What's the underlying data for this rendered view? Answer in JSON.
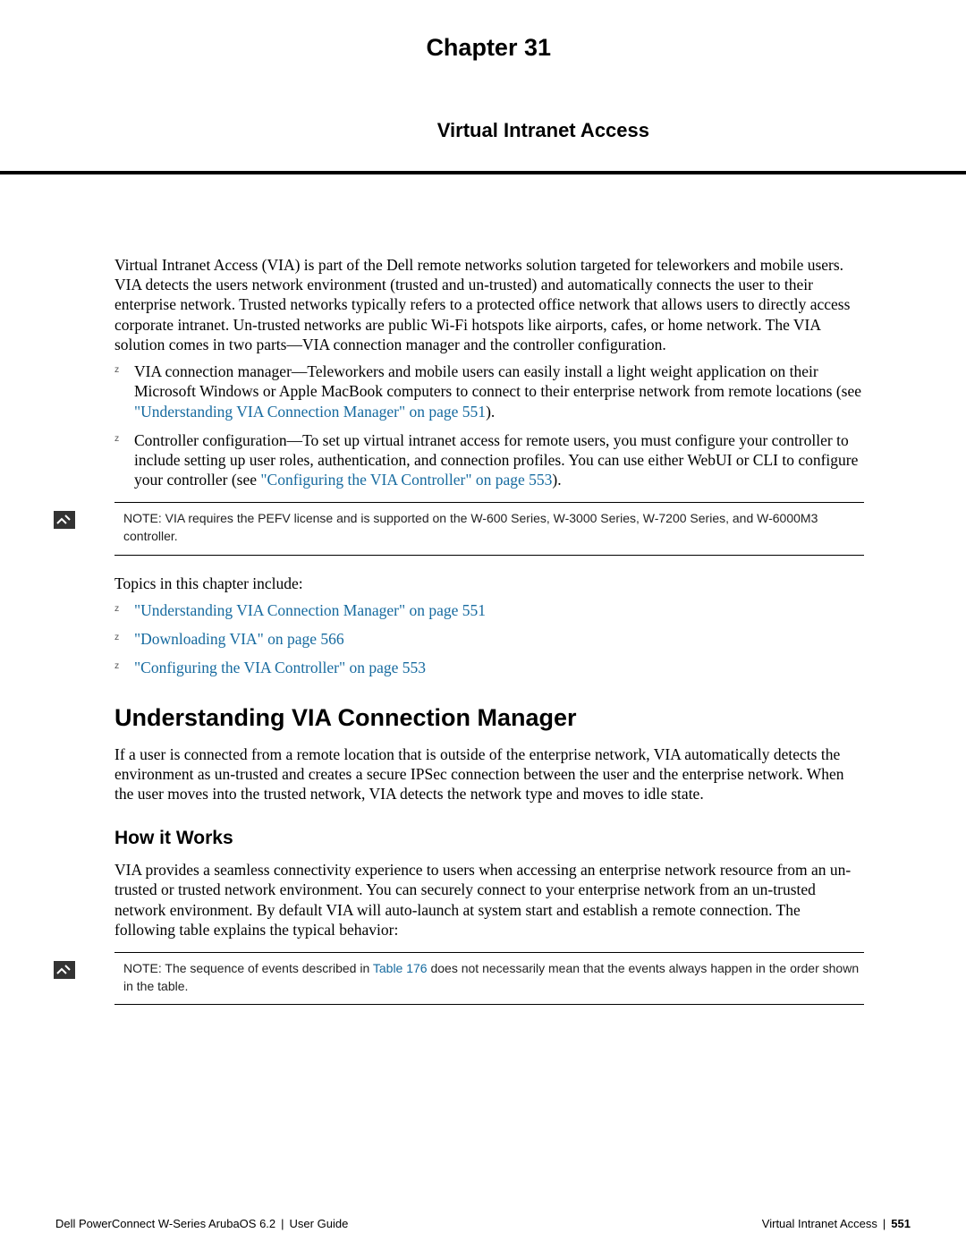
{
  "chapter_title": "Chapter 31",
  "chapter_subtitle": "Virtual Intranet Access",
  "intro_paragraph": "Virtual Intranet Access (VIA) is part of the Dell remote networks solution targeted for teleworkers and mobile users. VIA detects the users network environment (trusted and un-trusted) and automatically connects the user to their enterprise network. Trusted networks typically refers to a protected office network that allows users to directly access corporate intranet. Un-trusted networks are public Wi-Fi hotspots like airports, cafes, or home network. The VIA solution comes in two parts—VIA connection manager and the controller configuration.",
  "bullets1": {
    "item1_pre": "VIA connection manager—Teleworkers and mobile users can easily install a light weight application on their Microsoft Windows or Apple MacBook computers to connect to their enterprise network from remote locations (see ",
    "item1_link": "\"Understanding VIA Connection Manager\" on page 551",
    "item1_post": ").",
    "item2_pre": "Controller configuration—To set up virtual intranet access for remote users, you must configure your controller to include setting up user roles, authentication, and connection profiles. You can use either WebUI or CLI to configure your controller (see ",
    "item2_link": "\"Configuring the VIA Controller\" on page 553",
    "item2_post": ")."
  },
  "note1": "NOTE: VIA requires the PEFV license and is supported on the W-600 Series, W-3000 Series, W-7200 Series, and W-6000M3 controller.",
  "topics_intro": "Topics in this chapter include:",
  "topics": {
    "t1": "\"Understanding VIA Connection Manager\" on page 551",
    "t2": "\"Downloading VIA\" on page 566",
    "t3": "\"Configuring the VIA Controller\" on page 553"
  },
  "h1": "Understanding VIA Connection Manager",
  "p_understand": "If a user is connected from a remote location that is outside of the enterprise network, VIA automatically detects the environment as un-trusted and creates a secure IPSec connection between the user and the enterprise network. When the user moves into the trusted network, VIA detects the network type and moves to idle state.",
  "h2": "How it Works",
  "p_how": "VIA provides a seamless connectivity experience to users when accessing an enterprise network resource from an un-trusted or trusted network environment. You can securely connect to your enterprise network from an un-trusted network environment. By default VIA will auto-launch at system start and establish a remote connection. The following table explains the typical behavior:",
  "note2_pre": "NOTE: The sequence of events described in ",
  "note2_link": "Table 176",
  "note2_post": " does not necessarily mean that the events always happen in the order shown in the table.",
  "footer_left_a": "Dell PowerConnect W-Series ArubaOS 6.2",
  "footer_left_b": "User Guide",
  "footer_right_a": "Virtual Intranet Access",
  "footer_right_b": "551"
}
